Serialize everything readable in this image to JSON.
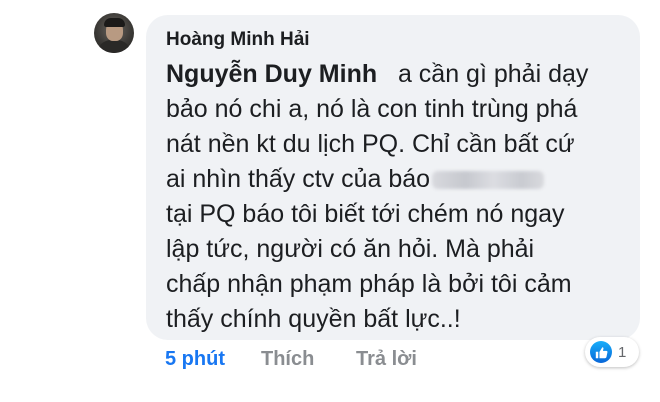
{
  "comment": {
    "author": "Hoàng Minh Hải",
    "mention": "Nguyễn Duy Minh",
    "lines": [
      "a cần gì phải dạy",
      "bảo nó chi a, nó là con tinh trùng phá",
      "nát nền kt du lịch PQ. Chỉ cần bất cứ",
      "ai nhìn thấy ctv của báo",
      "tại PQ báo tôi biết tới chém nó ngay",
      "lập tức, người có ăn hỏi. Mà phải",
      "chấp nhận phạm pháp là bởi tôi cảm",
      "thấy chính quyền bất lực..!"
    ]
  },
  "actions": {
    "time": "5 phút",
    "like": "Thích",
    "reply": "Trả lời"
  },
  "reactions": {
    "icon": "thumbs-up-icon",
    "count": "1"
  },
  "colors": {
    "accent": "#1877f2",
    "bubble": "#f0f2f5",
    "muted": "#8a8d91"
  }
}
